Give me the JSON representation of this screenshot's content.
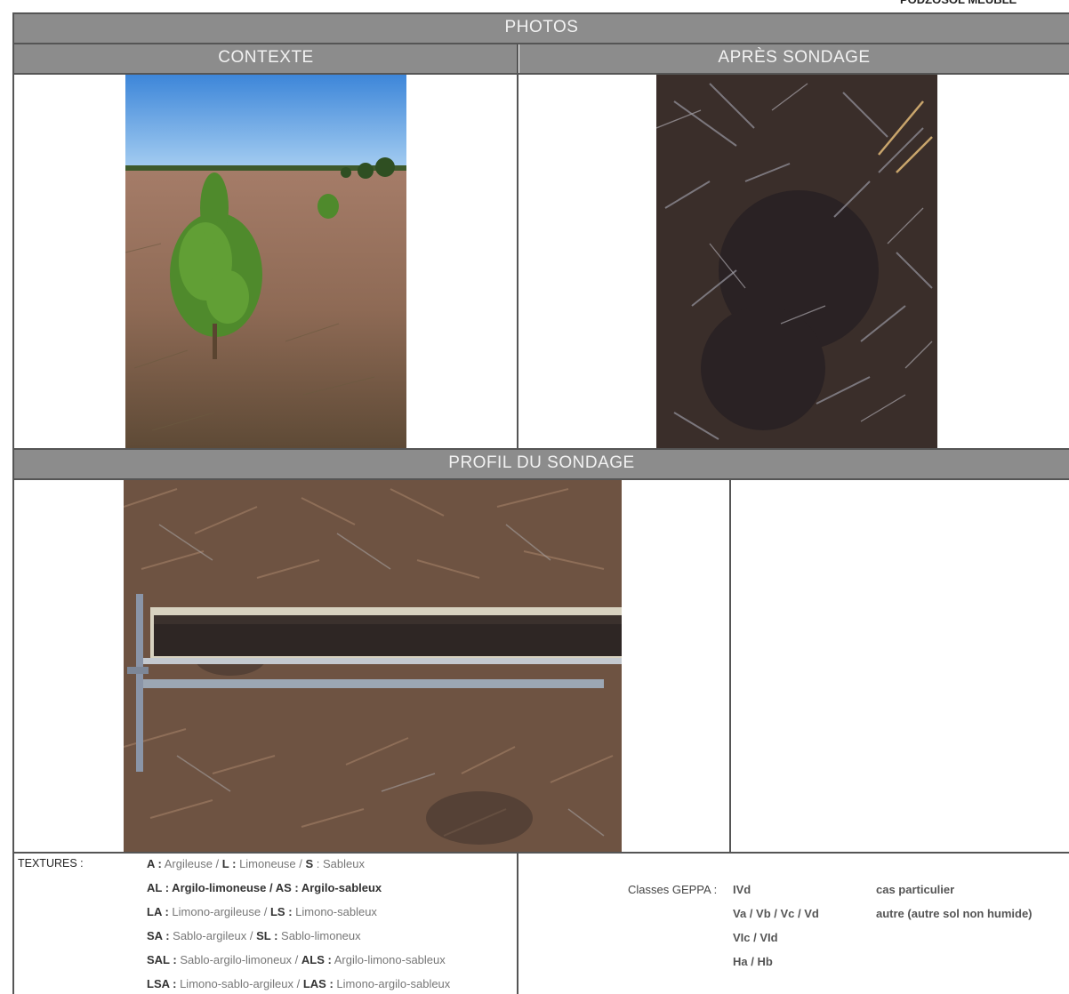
{
  "header": {
    "corner_title": "PODZOSOL MEUBLE"
  },
  "sections": {
    "photos": "PHOTOS",
    "context": "CONTEXTE",
    "after": "APRÈS SONDAGE",
    "profile": "PROFIL DU SONDAGE"
  },
  "textures": {
    "label": "TEXTURES :",
    "lines": [
      [
        {
          "code": "A :",
          "desc": " Argileuse / "
        },
        {
          "code": "L :",
          "desc": " Limoneuse / "
        },
        {
          "code": "S",
          "desc": " : Sableux"
        }
      ],
      [
        {
          "code": "AL :",
          "desc": " Argilo-limoneuse / "
        },
        {
          "code": "AS :",
          "desc": " Argilo-sableux"
        }
      ],
      [
        {
          "code": "LA :",
          "desc": " Limono-argileuse / "
        },
        {
          "code": "LS :",
          "desc": " Limono-sableux"
        }
      ],
      [
        {
          "code": "SA :",
          "desc": " Sablo-argileux / "
        },
        {
          "code": "SL :",
          "desc": " Sablo-limoneux"
        }
      ],
      [
        {
          "code": "SAL :",
          "desc": " Sablo-argilo-limoneux  / "
        },
        {
          "code": "ALS :",
          "desc": " Argilo-limono-sableux"
        }
      ],
      [
        {
          "code": "LSA :",
          "desc": " Limono-sablo-argileux /  "
        },
        {
          "code": "LAS :",
          "desc": " Limono-argilo-sableux"
        }
      ]
    ]
  },
  "geppa": {
    "label": "Classes GEPPA :",
    "classes": [
      "IVd",
      "Va / Vb / Vc / Vd",
      "VIc / VId",
      "Ha / Hb"
    ],
    "special_label": "cas particulier",
    "special_value": "autre (autre sol non humide)"
  }
}
